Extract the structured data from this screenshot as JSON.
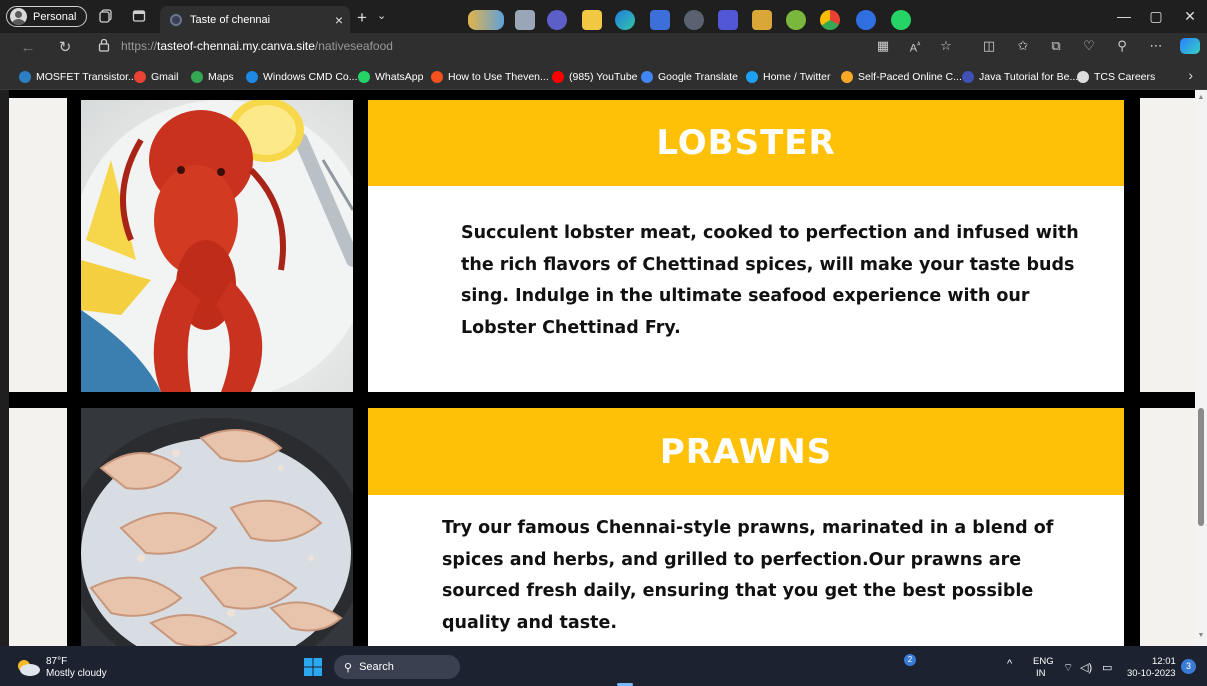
{
  "browser": {
    "profile_label": "Personal",
    "tab_title": "Taste of chennai",
    "url_prefix": "https://",
    "url_domain": "tasteof-chennai.my.canva.site",
    "url_path": "/nativeseafood",
    "tab_close_glyph": "×",
    "newtab_glyph": "+",
    "tab_dropdown_glyph": "⌄",
    "minimize_glyph": "—",
    "maximize_glyph": "▢",
    "close_glyph": "✕"
  },
  "bookmarks": [
    {
      "label": "MOSFET Transistor...",
      "icon": "wordpress-icon",
      "color": "#2b7fc2"
    },
    {
      "label": "Gmail",
      "icon": "google-icon",
      "color": "#ea4335"
    },
    {
      "label": "Maps",
      "icon": "maps-icon",
      "color": "#34a853"
    },
    {
      "label": "Windows CMD Co...",
      "icon": "windows-cmd-icon",
      "color": "#1e88e5"
    },
    {
      "label": "WhatsApp",
      "icon": "whatsapp-icon",
      "color": "#25d366"
    },
    {
      "label": "How to Use Theven...",
      "icon": "bookmark-icon",
      "color": "#f4511e"
    },
    {
      "label": "(985) YouTube",
      "icon": "youtube-icon",
      "color": "#ff0000"
    },
    {
      "label": "Google Translate",
      "icon": "translate-icon",
      "color": "#4285f4"
    },
    {
      "label": "Home / Twitter",
      "icon": "twitter-icon",
      "color": "#1da1f2"
    },
    {
      "label": "Self-Paced Online C...",
      "icon": "geeksforgeeks-icon",
      "color": "#f9a825"
    },
    {
      "label": "Java Tutorial for Be...",
      "icon": "java-icon",
      "color": "#3f51b5"
    },
    {
      "label": "TCS Careers",
      "icon": "page-icon",
      "color": "#dddddd"
    }
  ],
  "sections": [
    {
      "title": "LOBSTER",
      "lines": [
        "Succulent lobster meat, cooked to perfection and infused with",
        "the rich flavors of Chettinad spices, will make your taste buds",
        "sing. Indulge in the ultimate seafood experience with our",
        "Lobster Chettinad Fry."
      ]
    },
    {
      "title": "PRAWNS",
      "lines": [
        "Try our famous Chennai-style prawns, marinated in a blend of",
        "spices and herbs, and grilled to perfection.Our prawns are",
        "sourced fresh daily, ensuring that you get the best possible",
        "quality and taste."
      ]
    }
  ],
  "taskbar": {
    "temperature": "87°F",
    "weather": "Mostly cloudy",
    "search_label": "Search",
    "lang_top": "ENG",
    "lang_bottom": "IN",
    "time": "12:01",
    "date": "30-10-2023",
    "notification_count": "3",
    "whatsapp_badge": "2"
  },
  "colors": {
    "accent_yellow": "#ffc107",
    "page_cream": "#f3f2ee"
  }
}
